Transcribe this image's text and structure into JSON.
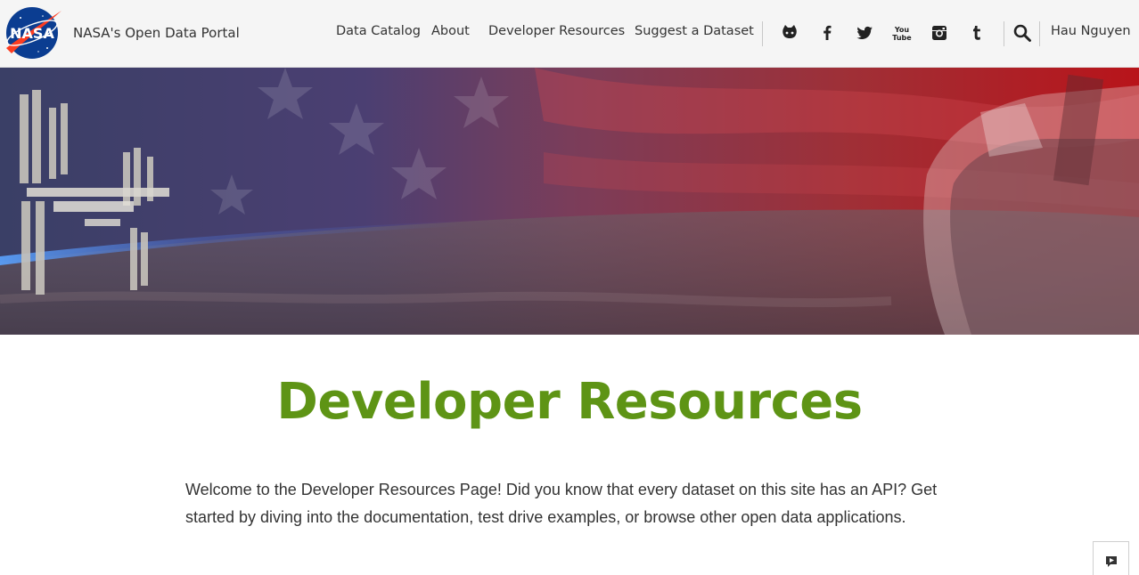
{
  "header": {
    "logo_text": "NASA",
    "site_title": "NASA's Open Data Portal",
    "nav": [
      {
        "label": "Data Catalog"
      },
      {
        "label": "About"
      },
      {
        "label": "Developer Resources"
      },
      {
        "label": "Suggest a Dataset"
      }
    ],
    "social_icons": [
      "github-icon",
      "facebook-icon",
      "twitter-icon",
      "youtube-icon",
      "instagram-icon",
      "tumblr-icon"
    ],
    "search_icon": "search-icon",
    "user_name": "Hau Nguyen"
  },
  "main": {
    "title": "Developer Resources",
    "intro": "Welcome to the Developer Resources Page! Did you know that every dataset on this site has an API? Get started by diving into the documentation, test drive examples, or browse other open data applications."
  },
  "feedback": {
    "icon": "feedback-icon"
  },
  "colors": {
    "title_green": "#5e9415",
    "nasa_blue": "#0b3d91",
    "nasa_red": "#fc3d21",
    "topbar_bg": "#f5f5f5"
  }
}
